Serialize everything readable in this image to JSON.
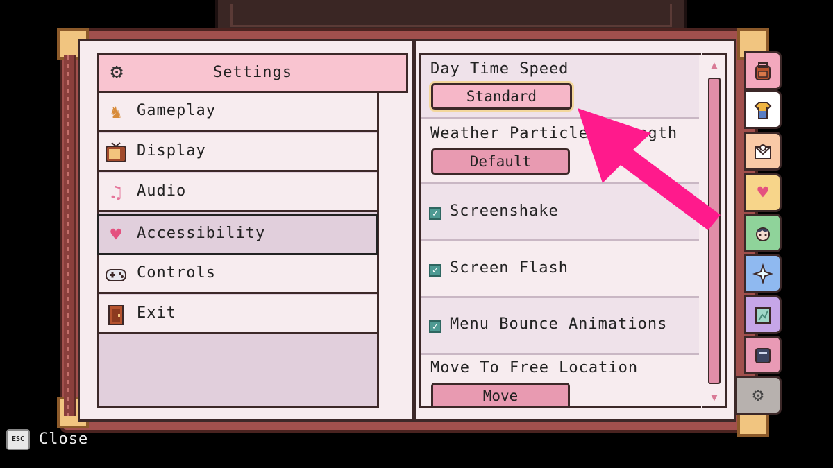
{
  "menu": {
    "header_icon": "gear-icon",
    "title": "Settings",
    "items": [
      {
        "label": "Gameplay",
        "icon": "horse-knight-icon",
        "selected": false
      },
      {
        "label": "Display",
        "icon": "tv-icon",
        "selected": false
      },
      {
        "label": "Audio",
        "icon": "music-notes-icon",
        "selected": false
      },
      {
        "label": "Accessibility",
        "icon": "heart-icon",
        "selected": true
      },
      {
        "label": "Controls",
        "icon": "gamepad-icon",
        "selected": false
      },
      {
        "label": "Exit",
        "icon": "door-icon",
        "selected": false
      }
    ]
  },
  "options": {
    "day_time_speed": {
      "label": "Day Time Speed",
      "value": "Standard"
    },
    "weather_particles": {
      "label": "Weather Particle Strength",
      "value": "Default"
    },
    "screenshake": {
      "label": "Screenshake",
      "checked": true
    },
    "screen_flash": {
      "label": "Screen Flash",
      "checked": true
    },
    "menu_bounce": {
      "label": "Menu Bounce Animations",
      "checked": true
    },
    "move_location": {
      "label": "Move To Free Location",
      "value": "Move"
    }
  },
  "tabs": [
    {
      "icon": "backpack-icon",
      "color": "#f3a8bd"
    },
    {
      "icon": "shirt-icon",
      "color": "#ffffff"
    },
    {
      "icon": "letter-icon",
      "color": "#f9c9a6"
    },
    {
      "icon": "heart-icon",
      "color": "#f7d58a"
    },
    {
      "icon": "character-icon",
      "color": "#8fd39a"
    },
    {
      "icon": "sparkle-icon",
      "color": "#8fb9f0"
    },
    {
      "icon": "map-icon",
      "color": "#c6a6e8"
    },
    {
      "icon": "journal-icon",
      "color": "#e99ab5"
    },
    {
      "icon": "gear-icon",
      "color": "#b7b1ae"
    }
  ],
  "footer": {
    "key": "ESC",
    "label": "Close"
  },
  "colors": {
    "accent_arrow": "#ff1a8c",
    "page": "#f7ecef",
    "header": "#f9c4d0",
    "button": "#e89ab1"
  }
}
